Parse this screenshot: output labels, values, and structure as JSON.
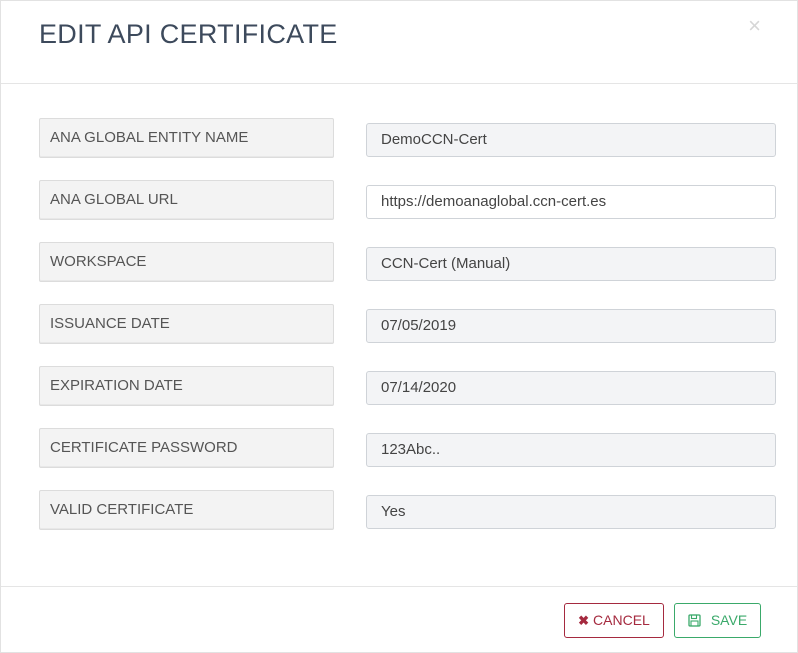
{
  "modal": {
    "title": "EDIT API CERTIFICATE",
    "close_symbol": "×"
  },
  "fields": [
    {
      "label": "ANA GLOBAL ENTITY NAME",
      "value": "DemoCCN-Cert",
      "editable": false
    },
    {
      "label": "ANA GLOBAL URL",
      "value": "https://demoanaglobal.ccn-cert.es",
      "editable": true
    },
    {
      "label": "WORKSPACE",
      "value": "CCN-Cert (Manual)",
      "editable": false
    },
    {
      "label": "ISSUANCE DATE",
      "value": "07/05/2019",
      "editable": false
    },
    {
      "label": "EXPIRATION DATE",
      "value": "07/14/2020",
      "editable": false
    },
    {
      "label": "CERTIFICATE PASSWORD",
      "value": "123Abc..",
      "editable": false
    },
    {
      "label": "VALID CERTIFICATE",
      "value": "Yes",
      "editable": false
    }
  ],
  "footer": {
    "cancel_label": "CANCEL",
    "cancel_icon": "close-icon",
    "save_label": "SAVE",
    "save_icon": "save-icon"
  },
  "colors": {
    "title": "#3d4a5c",
    "cancel": "#a52a3f",
    "save": "#3aa96a"
  }
}
